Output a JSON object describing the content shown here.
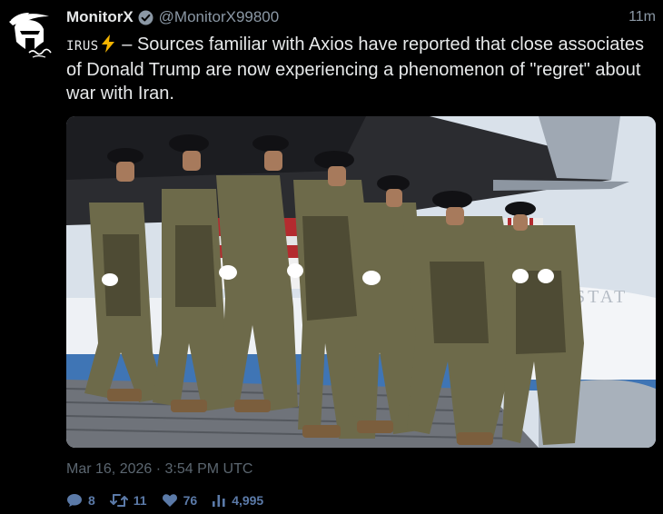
{
  "author": {
    "display_name": "MonitorX",
    "handle": "@MonitorX99800",
    "verified": true,
    "time_ago": "11m",
    "avatar_icon": "spartan-helmet-logo"
  },
  "tweet": {
    "prefix_tag": "IRUS",
    "prefix_icon": "lightning-bolt-icon",
    "text": " – Sources familiar with Axios have reported that close associates of Donald Trump are now experiencing a phenomenon of \"regret\" about war with Iran."
  },
  "media": {
    "kind": "photo"
  },
  "meta": {
    "timestamp": "Mar 16, 2026 · 3:54 PM UTC"
  },
  "stats": {
    "replies": "8",
    "retweets": "11",
    "likes": "76",
    "views": "4,995"
  },
  "colors": {
    "background": "#000000",
    "text": "#e7e9ea",
    "muted": "#8b98a5",
    "stats": "#5b7aa8",
    "verified": "#8b98a5",
    "bolt": "#f5b400"
  }
}
